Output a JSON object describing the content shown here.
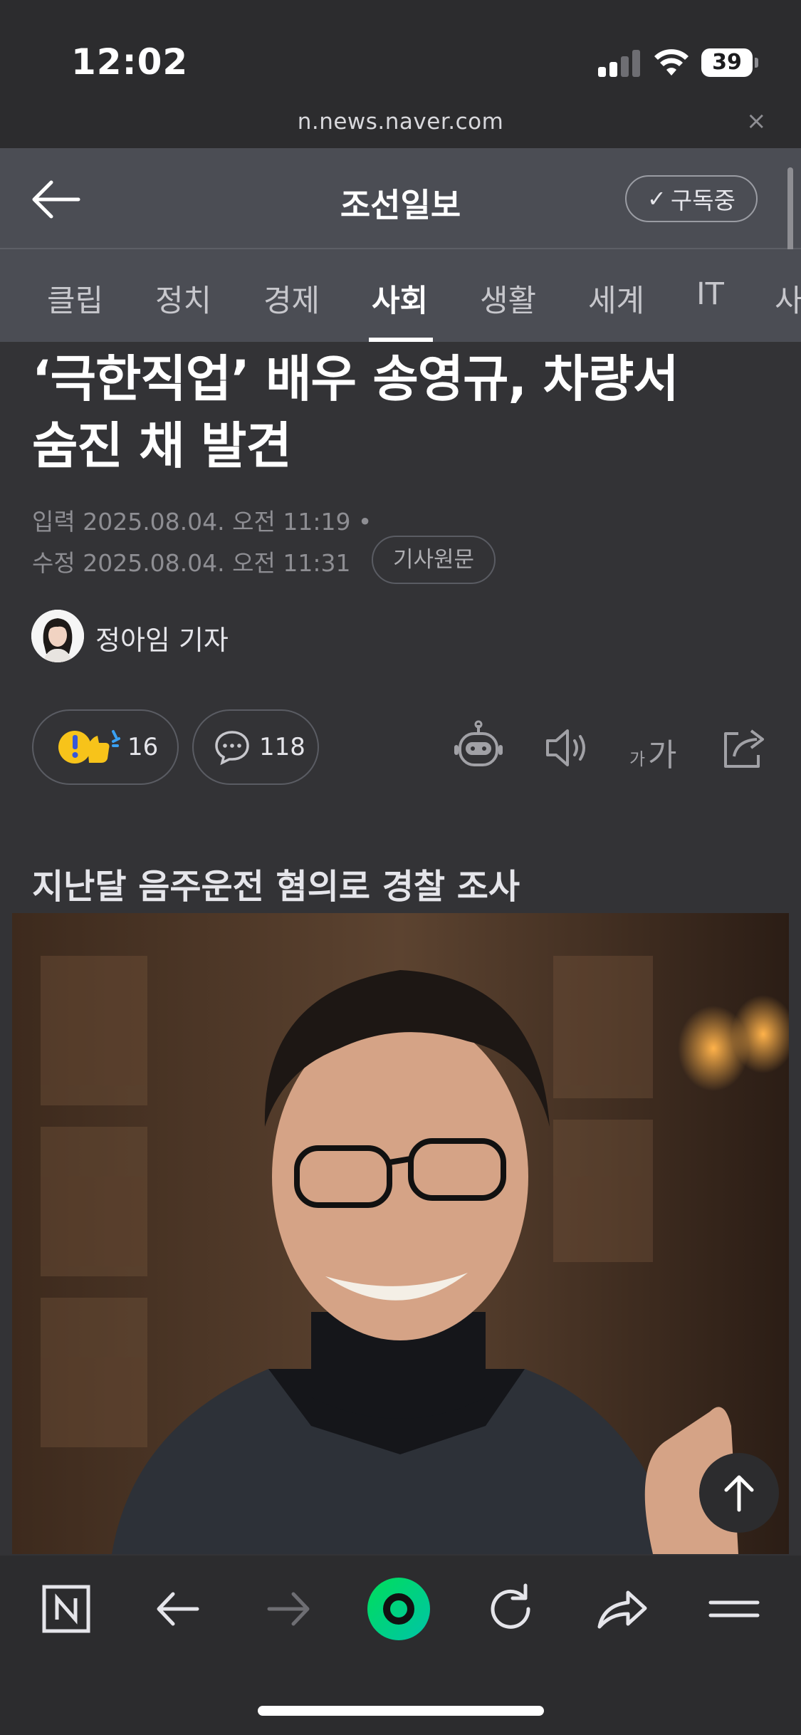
{
  "status_bar": {
    "time": "12:02",
    "battery": "39"
  },
  "browser": {
    "url": "n.news.naver.com",
    "close": "×"
  },
  "header": {
    "press_name": "조선일보",
    "subscribe_label": "구독중",
    "subscribe_check": "✓"
  },
  "tabs": [
    {
      "label": "클립"
    },
    {
      "label": "정치"
    },
    {
      "label": "경제"
    },
    {
      "label": "사회",
      "active": true
    },
    {
      "label": "생활"
    },
    {
      "label": "세계"
    },
    {
      "label": "IT"
    },
    {
      "label": "사"
    }
  ],
  "article": {
    "headline_line1": "‘극한직업’ 배우 송영규, 차량서",
    "headline_line2": "숨진 채 발견",
    "published": "입력 2025.08.04. 오전 11:19 •",
    "modified": "수정 2025.08.04. 오전 11:31",
    "original_label": "기사원문",
    "reporter": "정아임 기자",
    "reaction_count": "16",
    "comment_count": "118",
    "font_size_label_small": "가",
    "font_size_label_large": "가",
    "subheading": "지난달 음주운전 혐의로 경찰 조사"
  },
  "colors": {
    "accent_green": "#03c75a",
    "background": "#333336",
    "header": "#4b4d54"
  }
}
